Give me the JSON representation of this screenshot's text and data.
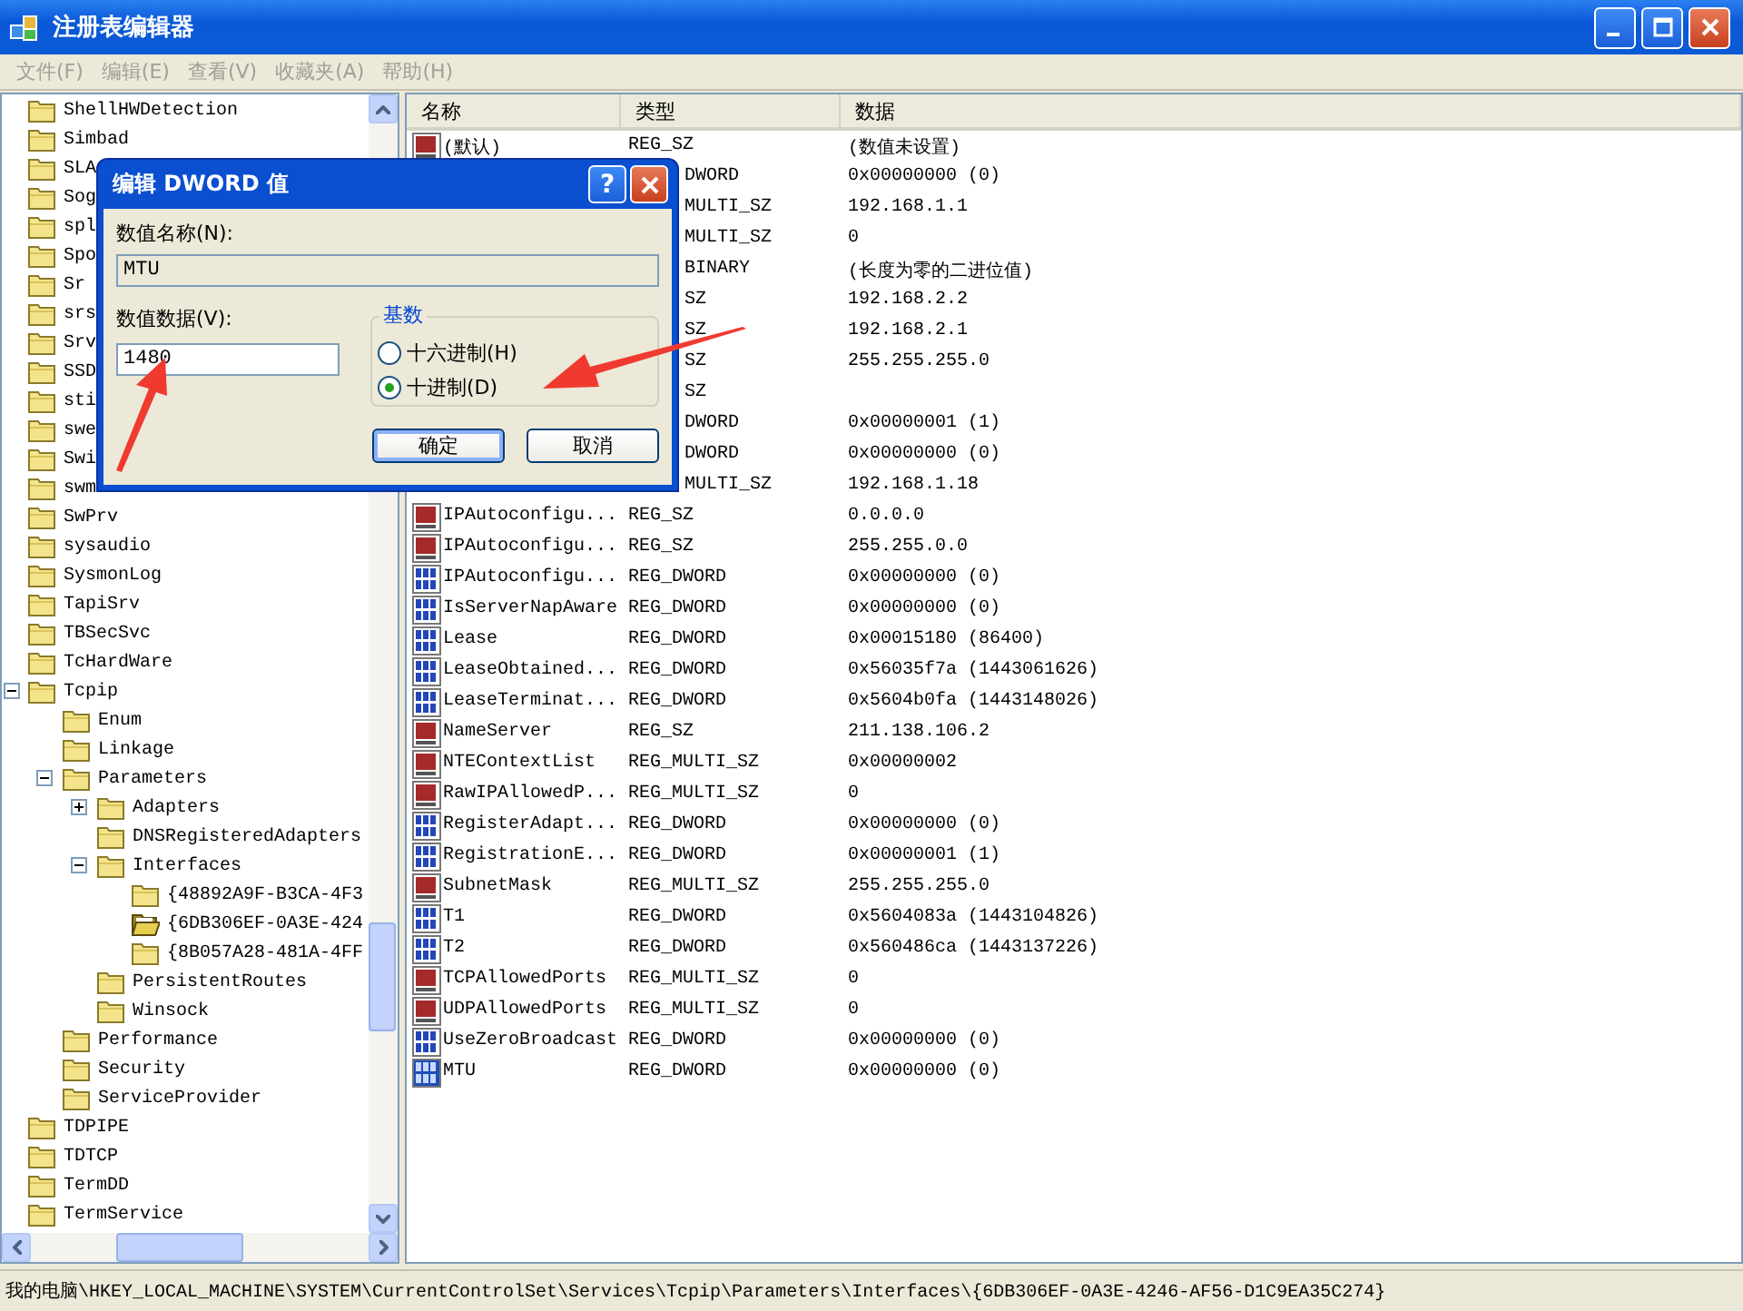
{
  "window": {
    "title": "注册表编辑器"
  },
  "menu": [
    {
      "label": "文件(F)",
      "disabled": true
    },
    {
      "label": "编辑(E)",
      "disabled": true
    },
    {
      "label": "查看(V)",
      "disabled": true
    },
    {
      "label": "收藏夹(A)",
      "disabled": true
    },
    {
      "label": "帮助(H)",
      "disabled": true
    }
  ],
  "tree": {
    "items": [
      {
        "label": "ShellHWDetection"
      },
      {
        "label": "Simbad"
      },
      {
        "label": "SLA"
      },
      {
        "label": "Sog"
      },
      {
        "label": "spl"
      },
      {
        "label": "Spo"
      },
      {
        "label": "Sr"
      },
      {
        "label": "srs"
      },
      {
        "label": "Srv"
      },
      {
        "label": "SSD"
      },
      {
        "label": "sti"
      },
      {
        "label": "swe"
      },
      {
        "label": "Swi"
      },
      {
        "label": "swm"
      },
      {
        "label": "SwPrv"
      },
      {
        "label": "sysaudio"
      },
      {
        "label": "SysmonLog"
      },
      {
        "label": "TapiSrv"
      },
      {
        "label": "TBSecSvc"
      },
      {
        "label": "TcHardWare"
      },
      {
        "label": "Tcpip",
        "expanded": true,
        "children": [
          {
            "label": "Enum"
          },
          {
            "label": "Linkage"
          },
          {
            "label": "Parameters",
            "expanded": true,
            "children": [
              {
                "label": "Adapters",
                "expanded": false
              },
              {
                "label": "DNSRegisteredAdapters"
              },
              {
                "label": "Interfaces",
                "expanded": true,
                "children": [
                  {
                    "label": "{48892A9F-B3CA-4F3",
                    "selected": false
                  },
                  {
                    "label": "{6DB306EF-0A3E-424",
                    "selected": true
                  },
                  {
                    "label": "{8B057A28-481A-4FF",
                    "selected": false
                  }
                ]
              },
              {
                "label": "PersistentRoutes"
              },
              {
                "label": "Winsock"
              }
            ]
          },
          {
            "label": "Performance"
          },
          {
            "label": "Security"
          },
          {
            "label": "ServiceProvider"
          }
        ]
      },
      {
        "label": "TDPIPE"
      },
      {
        "label": "TDTCP"
      },
      {
        "label": "TermDD"
      },
      {
        "label": "TermService"
      }
    ]
  },
  "list": {
    "columns": [
      "名称",
      "类型",
      "数据"
    ],
    "rows": [
      {
        "kind": "string",
        "name": "(默认)",
        "type": "REG_SZ",
        "data": "(数值未设置)",
        "covered": false,
        "selected": false
      },
      {
        "type": "DWORD",
        "data": "0x00000000 (0)",
        "covered": true
      },
      {
        "type": "MULTI_SZ",
        "data": "192.168.1.1",
        "covered": true
      },
      {
        "type": "MULTI_SZ",
        "data": "0",
        "covered": true
      },
      {
        "type": "BINARY",
        "data": "(长度为零的二进位值)",
        "covered": true
      },
      {
        "type": "SZ",
        "data": "192.168.2.2",
        "covered": true
      },
      {
        "type": "SZ",
        "data": "192.168.2.1",
        "covered": true
      },
      {
        "type": "SZ",
        "data": "255.255.255.0",
        "covered": true
      },
      {
        "type": "SZ",
        "covered": true
      },
      {
        "type": "DWORD",
        "data": "0x00000001 (1)",
        "covered": true
      },
      {
        "type": "DWORD",
        "data": "0x00000000 (0)",
        "covered": true
      },
      {
        "type": "MULTI_SZ",
        "data": "192.168.1.18",
        "covered": true
      },
      {
        "kind": "string",
        "name": "IPAutoconfigu...",
        "type": "REG_SZ",
        "data": "0.0.0.0",
        "covered": false,
        "selected": false
      },
      {
        "kind": "string",
        "name": "IPAutoconfigu...",
        "type": "REG_SZ",
        "data": "255.255.0.0",
        "covered": false,
        "selected": false
      },
      {
        "kind": "binary",
        "name": "IPAutoconfigu...",
        "type": "REG_DWORD",
        "data": "0x00000000 (0)",
        "covered": false,
        "selected": false
      },
      {
        "kind": "binary",
        "name": "IsServerNapAware",
        "type": "REG_DWORD",
        "data": "0x00000000 (0)",
        "covered": false,
        "selected": false
      },
      {
        "kind": "binary",
        "name": "Lease",
        "type": "REG_DWORD",
        "data": "0x00015180 (86400)",
        "covered": false,
        "selected": false
      },
      {
        "kind": "binary",
        "name": "LeaseObtained...",
        "type": "REG_DWORD",
        "data": "0x56035f7a (1443061626)",
        "covered": false,
        "selected": false
      },
      {
        "kind": "binary",
        "name": "LeaseTerminat...",
        "type": "REG_DWORD",
        "data": "0x5604b0fa (1443148026)",
        "covered": false,
        "selected": false
      },
      {
        "kind": "string",
        "name": "NameServer",
        "type": "REG_SZ",
        "data": "211.138.106.2",
        "covered": false,
        "selected": false
      },
      {
        "kind": "string",
        "name": "NTEContextList",
        "type": "REG_MULTI_SZ",
        "data": "0x00000002",
        "covered": false,
        "selected": false
      },
      {
        "kind": "string",
        "name": "RawIPAllowedP...",
        "type": "REG_MULTI_SZ",
        "data": "0",
        "covered": false,
        "selected": false
      },
      {
        "kind": "binary",
        "name": "RegisterAdapt...",
        "type": "REG_DWORD",
        "data": "0x00000000 (0)",
        "covered": false,
        "selected": false
      },
      {
        "kind": "binary",
        "name": "RegistrationE...",
        "type": "REG_DWORD",
        "data": "0x00000001 (1)",
        "covered": false,
        "selected": false
      },
      {
        "kind": "string",
        "name": "SubnetMask",
        "type": "REG_MULTI_SZ",
        "data": "255.255.255.0",
        "covered": false,
        "selected": false
      },
      {
        "kind": "binary",
        "name": "T1",
        "type": "REG_DWORD",
        "data": "0x5604083a (1443104826)",
        "covered": false,
        "selected": false
      },
      {
        "kind": "binary",
        "name": "T2",
        "type": "REG_DWORD",
        "data": "0x560486ca (1443137226)",
        "covered": false,
        "selected": false
      },
      {
        "kind": "string",
        "name": "TCPAllowedPorts",
        "type": "REG_MULTI_SZ",
        "data": "0",
        "covered": false,
        "selected": false
      },
      {
        "kind": "string",
        "name": "UDPAllowedPorts",
        "type": "REG_MULTI_SZ",
        "data": "0",
        "covered": false,
        "selected": false
      },
      {
        "kind": "binary",
        "name": "UseZeroBroadcast",
        "type": "REG_DWORD",
        "data": "0x00000000 (0)",
        "covered": false,
        "selected": false
      },
      {
        "kind": "binary",
        "name": "MTU",
        "type": "REG_DWORD",
        "data": "0x00000000 (0)",
        "covered": false,
        "selected": true
      }
    ]
  },
  "dialog": {
    "title": "编辑 DWORD 值",
    "help": "?",
    "name_label": "数值名称(N):",
    "name_value": "MTU",
    "data_label": "数值数据(V):",
    "data_value": "1480",
    "base_label": "基数",
    "radios": [
      {
        "label": "十六进制(H)",
        "selected": false
      },
      {
        "label": "十进制(D)",
        "selected": true
      }
    ],
    "buttons": [
      {
        "label": "确定",
        "default": true
      },
      {
        "label": "取消",
        "default": false
      }
    ]
  },
  "status_bar": "我的电脑\\HKEY_LOCAL_MACHINE\\SYSTEM\\CurrentControlSet\\Services\\Tcpip\\Parameters\\Interfaces\\{6DB306EF-0A3E-4246-AF56-D1C9EA35C274}"
}
